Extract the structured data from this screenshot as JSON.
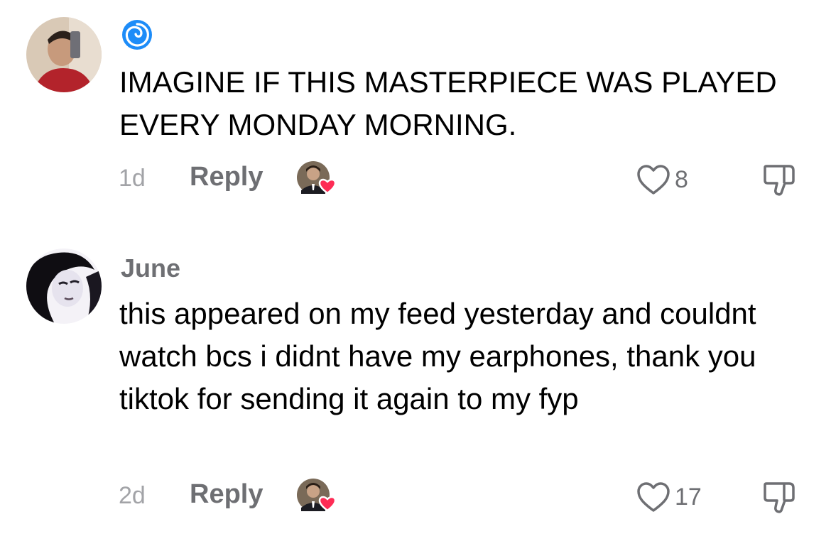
{
  "comments": [
    {
      "username": "",
      "username_icon": "cyclone-emoji-icon",
      "text": "IMAGINE IF THIS MASTERPIECE WAS PLAYED EVERY MONDAY MORNING.",
      "age": "1d",
      "reply_label": "Reply",
      "like_count": "8"
    },
    {
      "username": "June",
      "text": "this appeared on my feed yesterday and couldnt watch bcs i didnt have my earphones, thank you tiktok for sending it again to my fyp",
      "age": "2d",
      "reply_label": "Reply",
      "like_count": "17"
    }
  ],
  "colors": {
    "secondary_text": "#6e6f73",
    "age_text": "#a2a3a7",
    "heart_badge": "#fe2c55",
    "cyclone": "#1d8cf8"
  }
}
